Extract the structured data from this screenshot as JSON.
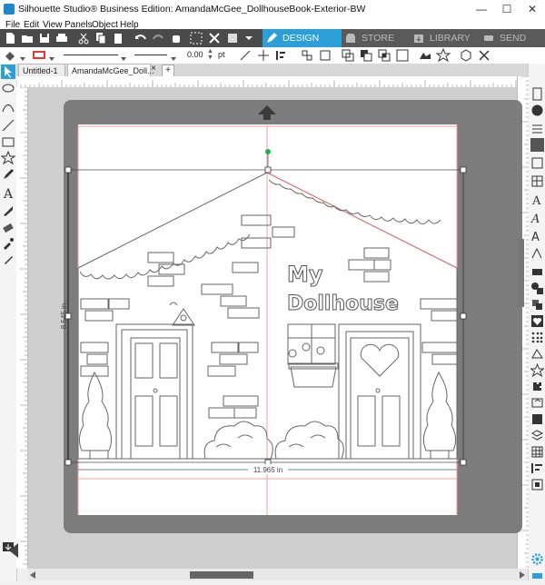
{
  "window": {
    "title": "Silhouette Studio® Business Edition: AmandaMcGee_DollhouseBook-Exterior-BW",
    "minimize": "—",
    "maximize": "☐",
    "close": "✕"
  },
  "menu": [
    "File",
    "Edit",
    "View",
    "Panels",
    "Object",
    "Help"
  ],
  "tabs": {
    "design": "DESIGN",
    "store": "STORE",
    "library": "LIBRARY",
    "send": "SEND"
  },
  "toolbar2": {
    "line_width_value": "0.00",
    "line_width_unit": "pt"
  },
  "documents": {
    "tab1": "Untitled-1",
    "tab2": "AmandaMcGee_Doll...",
    "tab2_close": "×",
    "add_tab": "+"
  },
  "canvas": {
    "dimension_width": "11.965 in",
    "dimension_height": "8.545 in",
    "title_line1": "My",
    "title_line2": "Dollhouse"
  },
  "colors": {
    "accent": "#2a9fd8",
    "mat": "#7d7d7d",
    "selection_handle": "#22b04a"
  }
}
